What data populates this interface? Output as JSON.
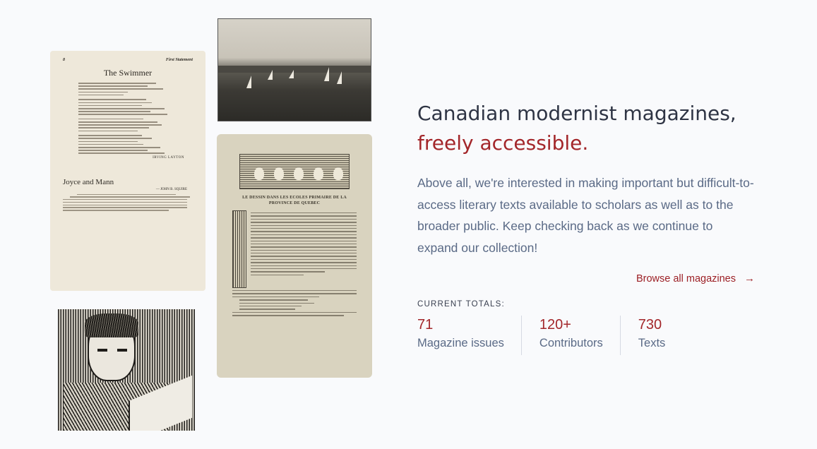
{
  "collage": {
    "page1": {
      "page_number": "8",
      "running_head": "First Statement",
      "poem_title": "The Swimmer",
      "poem_author": "IRVING LAYTON",
      "essay_title": "Joyce and Mann",
      "essay_author": "— JOHN B. SQUIRE"
    },
    "page2": {
      "title": "LE DESSIN DANS LES ECOLES PRIMAIRE DE LA PROVINCE DE QUEBEC"
    }
  },
  "hero": {
    "headline": "Canadian modernist magazines,",
    "headline_accent": "freely accessible.",
    "description": "Above all, we're interested in making important but difficult-to-access literary texts available to scholars as well as to the broader public. Keep checking back as we continue to expand our collection!",
    "browse_link": "Browse all magazines",
    "browse_icon": "arrow-right-icon"
  },
  "totals": {
    "label": "CURRENT TOTALS:",
    "stats": [
      {
        "value": "71",
        "label": "Magazine issues"
      },
      {
        "value": "120+",
        "label": "Contributors"
      },
      {
        "value": "730",
        "label": "Texts"
      }
    ]
  },
  "colors": {
    "accent": "#a3262a",
    "body_text": "#5a6a86",
    "heading": "#2e3444",
    "background": "#f9fafc"
  }
}
